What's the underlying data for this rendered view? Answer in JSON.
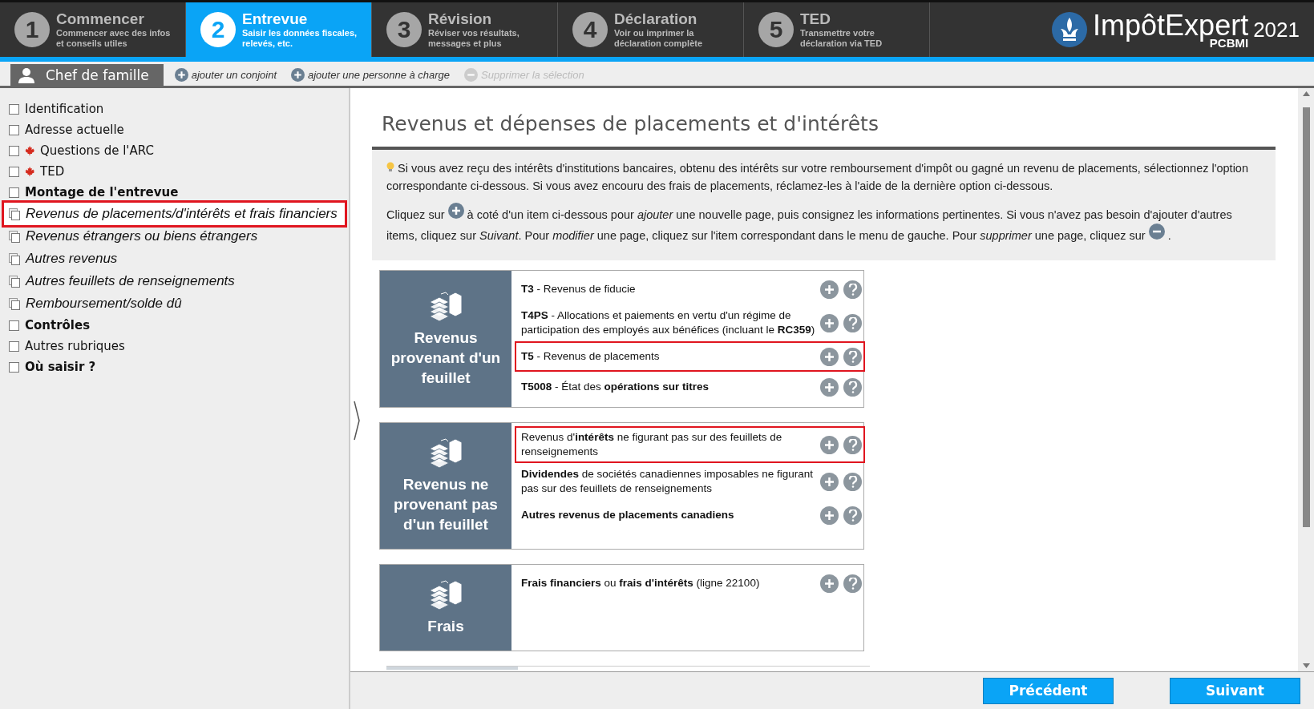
{
  "steps": [
    {
      "number": "1",
      "title": "Commencer",
      "subtitle": "Commencer avec des infos et conseils utiles",
      "selected": false
    },
    {
      "number": "2",
      "title": "Entrevue",
      "subtitle": "Saisir les données fiscales, relevés, etc.",
      "selected": true
    },
    {
      "number": "3",
      "title": "Révision",
      "subtitle": "Réviser vos résultats, messages et plus",
      "selected": false
    },
    {
      "number": "4",
      "title": "Déclaration",
      "subtitle": "Voir ou imprimer la déclaration complète",
      "selected": false
    },
    {
      "number": "5",
      "title": "TED",
      "subtitle": "Transmettre votre déclaration via TED",
      "selected": false
    }
  ],
  "logo": {
    "name": "ImpôtExpert",
    "edition": "PCBMI",
    "year": "2021"
  },
  "person_bar": {
    "current": "Chef de famille",
    "actions": [
      {
        "label": "ajouter un conjoint",
        "disabled": false
      },
      {
        "label": "ajouter une personne à charge",
        "disabled": false
      },
      {
        "label": "Supprimer la sélection",
        "disabled": true
      }
    ]
  },
  "sidebar": {
    "items": [
      {
        "label": "Identification",
        "kind": "check",
        "bold": false,
        "flag": false,
        "selected": false
      },
      {
        "label": "Adresse actuelle",
        "kind": "check",
        "bold": false,
        "flag": false,
        "selected": false
      },
      {
        "label": "Questions de l'ARC",
        "kind": "check",
        "bold": false,
        "flag": true,
        "selected": false
      },
      {
        "label": "TED",
        "kind": "check",
        "bold": false,
        "flag": true,
        "selected": false
      },
      {
        "label": "Montage de l'entrevue",
        "kind": "check",
        "bold": true,
        "flag": false,
        "selected": false
      },
      {
        "label": "Revenus de placements/d'intérêts et frais financiers",
        "kind": "pages",
        "bold": false,
        "flag": false,
        "selected": true
      },
      {
        "label": "Revenus étrangers ou biens étrangers",
        "kind": "pages",
        "bold": false,
        "flag": false,
        "selected": false
      },
      {
        "label": "Autres revenus",
        "kind": "pages",
        "bold": false,
        "flag": false,
        "selected": false
      },
      {
        "label": "Autres feuillets de renseignements",
        "kind": "pages",
        "bold": false,
        "flag": false,
        "selected": false
      },
      {
        "label": "Remboursement/solde dû",
        "kind": "pages",
        "bold": false,
        "flag": false,
        "selected": false
      },
      {
        "label": "Contrôles",
        "kind": "check",
        "bold": true,
        "flag": false,
        "selected": false
      },
      {
        "label": "Autres rubriques",
        "kind": "check",
        "bold": false,
        "flag": false,
        "selected": false
      },
      {
        "label": "Où saisir ?",
        "kind": "check",
        "bold": true,
        "flag": false,
        "selected": false
      }
    ]
  },
  "page": {
    "title": "Revenus et dépenses de placements et d'intérêts",
    "info": [
      [
        {
          "kind": "bulb"
        },
        {
          "kind": "text",
          "text": "Si vous avez reçu des intérêts d'institutions bancaires, obtenu des intérêts sur votre remboursement d'impôt ou gagné un revenu de placements, sélectionnez l'option correspondante ci-dessous. Si vous avez encouru des frais de placements, réclamez-les à l'aide de la dernière option ci-dessous."
        }
      ],
      [
        {
          "kind": "text",
          "text": "Cliquez sur"
        },
        {
          "kind": "add"
        },
        {
          "kind": "text",
          "text": "à coté d'un item ci-dessous pour *ajouter* une nouvelle page, puis consignez les informations pertinentes. Si vous n'avez pas besoin d'ajouter d'autres items, cliquez sur *Suivant*. Pour *modifier* une page, cliquez sur l'item correspondant dans le menu de gauche. Pour *supprimer* une page, cliquez sur"
        },
        {
          "kind": "remove"
        },
        {
          "kind": "text",
          "text": "."
        }
      ]
    ],
    "groups": [
      {
        "title": "Revenus provenant d'un feuillet",
        "items": [
          {
            "text": "**T3** - Revenus de fiducie",
            "highlighted": false
          },
          {
            "text": "**T4PS** - Allocations et paiements en vertu d'un régime de participation des employés aux bénéfices (incluant le **RC359**)",
            "highlighted": false
          },
          {
            "text": "**T5** - Revenus de placements",
            "highlighted": true
          },
          {
            "text": "**T5008** - État des **opérations sur titres**",
            "highlighted": false
          }
        ]
      },
      {
        "title": "Revenus ne provenant pas d'un feuillet",
        "items": [
          {
            "text": "Revenus d'**intérêts** ne figurant pas sur des feuillets de renseignements",
            "highlighted": true
          },
          {
            "text": "**Dividendes** de sociétés canadiennes imposables ne figurant pas sur des feuillets de renseignements",
            "highlighted": false
          },
          {
            "text": "**Autres revenus de placements canadiens**",
            "highlighted": false
          }
        ]
      },
      {
        "title": "Frais",
        "items": [
          {
            "text": "**Frais financiers** ou **frais d'intérêts** (ligne 22100)",
            "highlighted": false
          }
        ]
      }
    ]
  },
  "footer": {
    "buttons": [
      "Précédent",
      "Suivant"
    ]
  }
}
